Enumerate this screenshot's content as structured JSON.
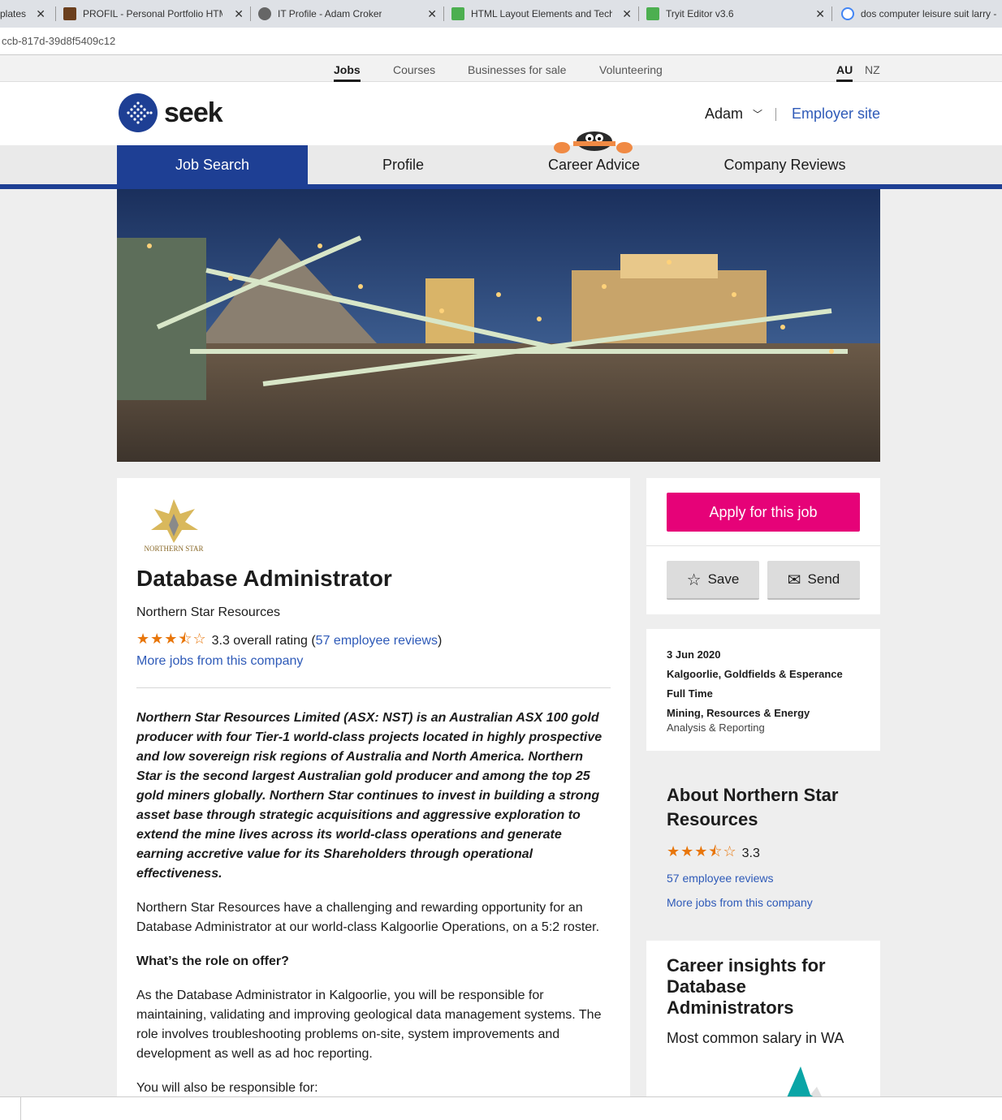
{
  "browser": {
    "tabs": [
      {
        "title": "plates",
        "favicon_color": "#ffffff"
      },
      {
        "title": "PROFIL - Personal Portfolio HTML",
        "favicon_color": "#6b3f1d"
      },
      {
        "title": "IT Profile - Adam Croker",
        "favicon_color": "#666666"
      },
      {
        "title": "HTML Layout Elements and Techn",
        "favicon_color": "#4caf50"
      },
      {
        "title": "Tryit Editor v3.6",
        "favicon_color": "#4caf50"
      },
      {
        "title": "dos computer leisure suit larry -",
        "favicon_color": "#4285f4"
      }
    ],
    "url": "ccb-817d-39d8f5409c12"
  },
  "topnav": {
    "items": [
      "Jobs",
      "Courses",
      "Businesses for sale",
      "Volunteering"
    ],
    "regions": [
      "AU",
      "NZ"
    ]
  },
  "header": {
    "brand": "seek",
    "user": "Adam",
    "employer_link": "Employer site"
  },
  "mainnav": {
    "items": [
      "Job Search",
      "Profile",
      "Career Advice",
      "Company Reviews"
    ]
  },
  "job": {
    "logo_text": "NORTHERN STAR",
    "title": "Database Administrator",
    "company": "Northern Star Resources",
    "rating": "3.3",
    "rating_suffix": "overall rating (",
    "reviews_link": "57 employee reviews",
    "rating_close": ")",
    "more_jobs": "More jobs from this company",
    "intro": "Northern Star Resources Limited (ASX: NST) is an Australian ASX 100 gold producer with four Tier-1 world-class projects located in highly prospective and low sovereign risk regions of Australia and North America. Northern Star is the second largest Australian gold producer and among the top 25 gold miners globally. Northern Star continues to invest in building a strong asset base through strategic acquisitions and aggressive exploration to extend the mine lives across its world-class operations and generate earning accretive value for its Shareholders through operational effectiveness.",
    "para1": "Northern Star Resources have a challenging and rewarding opportunity for an Database Administrator at our world-class Kalgoorlie Operations, on a 5:2 roster.",
    "heading1": "What’s the role on offer?",
    "para2": "As the Database Administrator in Kalgoorlie, you will be responsible for maintaining, validating and improving geological data management systems. The role involves troubleshooting problems on-site, system improvements and development as well as ad hoc reporting.",
    "para3": "You will also be responsible for:"
  },
  "actions": {
    "apply": "Apply for this job",
    "save": "Save",
    "send": "Send"
  },
  "details": {
    "date": "3 Jun 2020",
    "location": "Kalgoorlie, Goldfields & Esperance",
    "work_type": "Full Time",
    "classification": "Mining, Resources & Energy",
    "subclassification": "Analysis & Reporting"
  },
  "about": {
    "title": "About Northern Star Resources",
    "rating": "3.3",
    "reviews_link": "57 employee reviews",
    "more_jobs": "More jobs from this company"
  },
  "insights": {
    "title": "Career insights for Database Administrators",
    "salary_label": "Most common salary in WA"
  },
  "colors": {
    "brand_blue": "#1e3f94",
    "apply_pink": "#e60278",
    "link_blue": "#2e5ab8",
    "star_orange": "#e8760b"
  }
}
